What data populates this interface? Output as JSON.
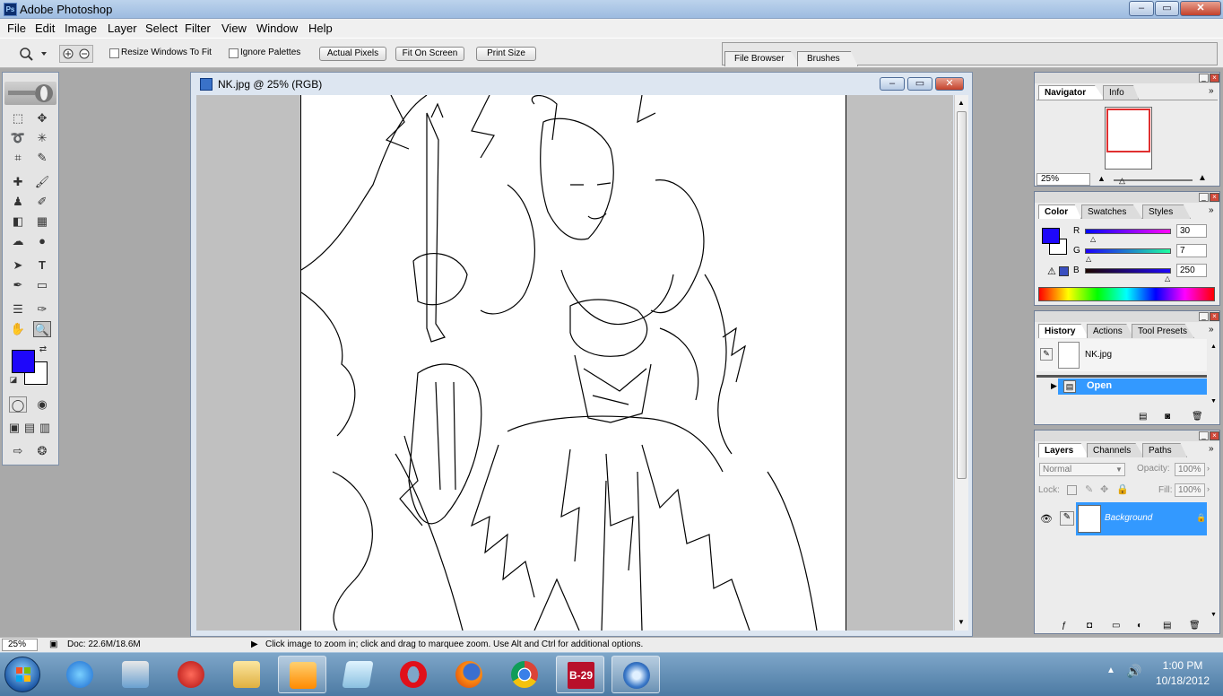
{
  "app": {
    "title": "Adobe Photoshop",
    "logo_text": "Ps"
  },
  "window_controls": {
    "minimize": "–",
    "maximize": "▭",
    "close": "✕"
  },
  "menu": [
    "File",
    "Edit",
    "Image",
    "Layer",
    "Select",
    "Filter",
    "View",
    "Window",
    "Help"
  ],
  "options": {
    "resize_windows": "Resize Windows To Fit",
    "ignore_palettes": "Ignore Palettes",
    "actual_pixels": "Actual Pixels",
    "fit_on_screen": "Fit On Screen",
    "print_size": "Print Size",
    "well_tabs": [
      "File Browser",
      "Brushes"
    ]
  },
  "document": {
    "title": "NK.jpg @ 25% (RGB)"
  },
  "navigator": {
    "tabs": [
      "Navigator",
      "Info"
    ],
    "zoom": "25%"
  },
  "color": {
    "tabs": [
      "Color",
      "Swatches",
      "Styles"
    ],
    "r_label": "R",
    "r_value": "30",
    "g_label": "G",
    "g_value": "7",
    "b_label": "B",
    "b_value": "250",
    "foreground": "#1e07fa"
  },
  "history": {
    "tabs": [
      "History",
      "Actions",
      "Tool Presets"
    ],
    "snapshot": "NK.jpg",
    "state": "Open"
  },
  "layers": {
    "tabs": [
      "Layers",
      "Channels",
      "Paths"
    ],
    "blend_mode": "Normal",
    "opacity_label": "Opacity:",
    "opacity_value": "100%",
    "lock_label": "Lock:",
    "fill_label": "Fill:",
    "fill_value": "100%",
    "layer_name": "Background"
  },
  "status": {
    "zoom": "25%",
    "doc": "Doc: 22.6M/18.6M",
    "hint": "Click image to zoom in; click and drag to marquee zoom.  Use Alt and Ctrl for additional options."
  },
  "taskbar": {
    "items": [
      "Internet Explorer",
      "Control Panel",
      "Adobe Reader",
      "Windows Explorer",
      "Media Player",
      "Notepad",
      "Opera",
      "Firefox",
      "Chrome",
      "B-29",
      "Photoshop"
    ],
    "b29_label": "B-29",
    "time": "1:00 PM",
    "date": "10/18/2012"
  },
  "colors": {
    "accent": "#3399ff",
    "selected_row": "#3399ff",
    "title_gradient": "#9dbbe0"
  }
}
